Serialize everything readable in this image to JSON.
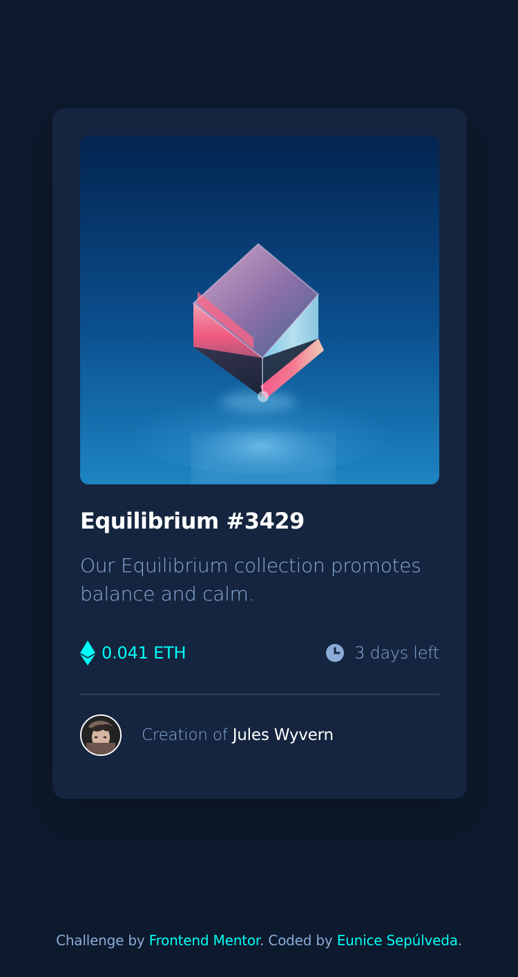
{
  "card": {
    "image_alt": "equilibrium-cube-image",
    "title": "Equilibrium #3429",
    "description": "Our Equilibrium collection promotes balance and calm.",
    "price": "0.041 ETH",
    "time_left": "3 days left",
    "creator_prefix": "Creation of",
    "creator_name": "Jules Wyvern",
    "icons": {
      "price": "ethereum-icon",
      "time": "clock-icon"
    }
  },
  "footer": {
    "challenge_prefix": "Challenge by",
    "challenge_link": "Frontend Mentor",
    "coded_prefix": ". Coded by",
    "coded_link": "Eunice Sepúlveda",
    "end": "."
  },
  "colors": {
    "background": "#0d192c",
    "card": "#15253f",
    "accent": "#00fff7",
    "muted_text": "#8bacd9",
    "divider": "#2e405a",
    "white": "#ffffff"
  }
}
